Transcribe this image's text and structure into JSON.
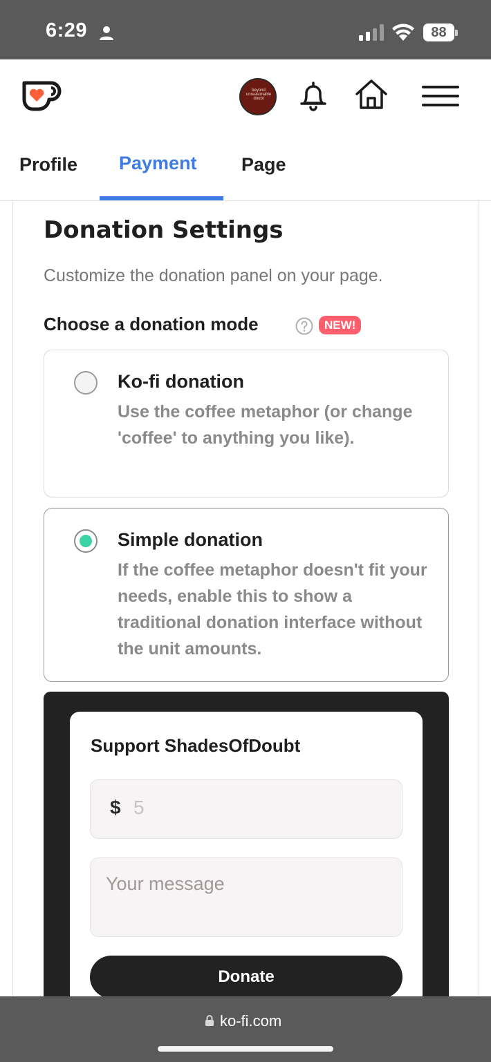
{
  "status_bar": {
    "time": "6:29",
    "battery": "88"
  },
  "header": {
    "logo_icon": "kofi-cup-icon",
    "avatar_text": "beyond unreasonable doubt",
    "icons": [
      "bell-icon",
      "home-icon",
      "hamburger-menu-icon"
    ]
  },
  "tabs": [
    {
      "label": "Profile",
      "active": false
    },
    {
      "label": "Payment",
      "active": true
    },
    {
      "label": "Page",
      "active": false
    }
  ],
  "settings": {
    "title": "Donation Settings",
    "subtitle": "Customize the donation panel on your page.",
    "mode_label": "Choose a donation mode",
    "new_badge": "NEW!",
    "options": [
      {
        "title": "Ko-fi donation",
        "description": "Use the coffee metaphor (or change 'coffee' to anything you like).",
        "selected": false
      },
      {
        "title": "Simple donation",
        "description": "If the coffee metaphor doesn't fit your needs, enable this to show a traditional donation interface without the unit amounts.",
        "selected": true
      }
    ]
  },
  "preview": {
    "title": "Support ShadesOfDoubt",
    "currency": "$",
    "amount_placeholder": "5",
    "message_placeholder": "Your message",
    "donate_label": "Donate"
  },
  "browser": {
    "url": "ko-fi.com"
  },
  "colors": {
    "accent": "#3f7be3",
    "radio_selected": "#3cd3a6",
    "badge": "#ff5e6c",
    "preview_bg": "#222222"
  }
}
